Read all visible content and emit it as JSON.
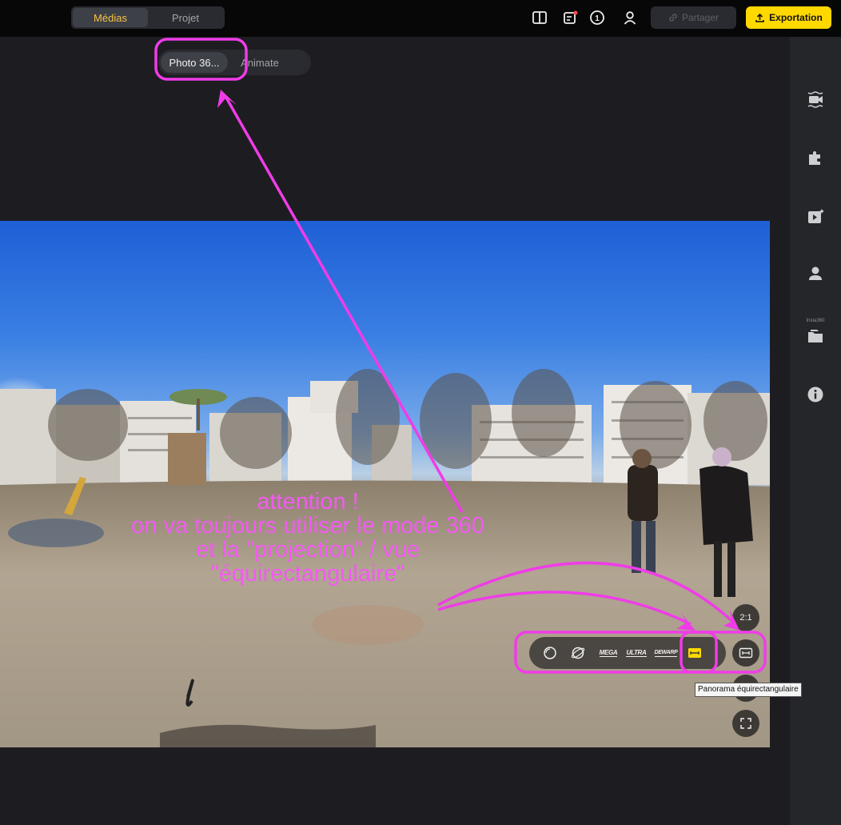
{
  "topbar": {
    "tabs": [
      {
        "label": "Médias",
        "active": true
      },
      {
        "label": "Projet",
        "active": false
      }
    ],
    "share_label": "Partager",
    "export_label": "Exportation"
  },
  "mode_tabs": [
    {
      "label": "Photo 36...",
      "active": true
    },
    {
      "label": "Animate",
      "active": false
    }
  ],
  "sidebar": {
    "items": [
      {
        "icon": "video-stabilize-icon"
      },
      {
        "icon": "plugin-puzzle-icon"
      },
      {
        "icon": "ai-video-icon"
      },
      {
        "icon": "insta360-user-icon",
        "label": "Insta360"
      },
      {
        "icon": "folder-icon"
      },
      {
        "icon": "info-icon"
      }
    ]
  },
  "viewer": {
    "projections": [
      {
        "icon": "fisheye-circle-icon"
      },
      {
        "icon": "tiny-planet-icon"
      },
      {
        "label": "MEGA"
      },
      {
        "label": "ULTRA"
      },
      {
        "label": "DEWARP"
      },
      {
        "icon": "equirectangular-icon",
        "active": true
      }
    ],
    "ratio_label": "2:1",
    "tooltip": "Panorama équirectangulaire"
  },
  "annotation": {
    "lines": [
      "attention !",
      "on va toujours utiliser le mode 360",
      "et la \"projection\" / vue",
      "\"équirectangulaire\""
    ]
  },
  "colors": {
    "accent": "#ffd800",
    "tab_active_text": "#f6c343",
    "annotation": "#f35af2"
  }
}
